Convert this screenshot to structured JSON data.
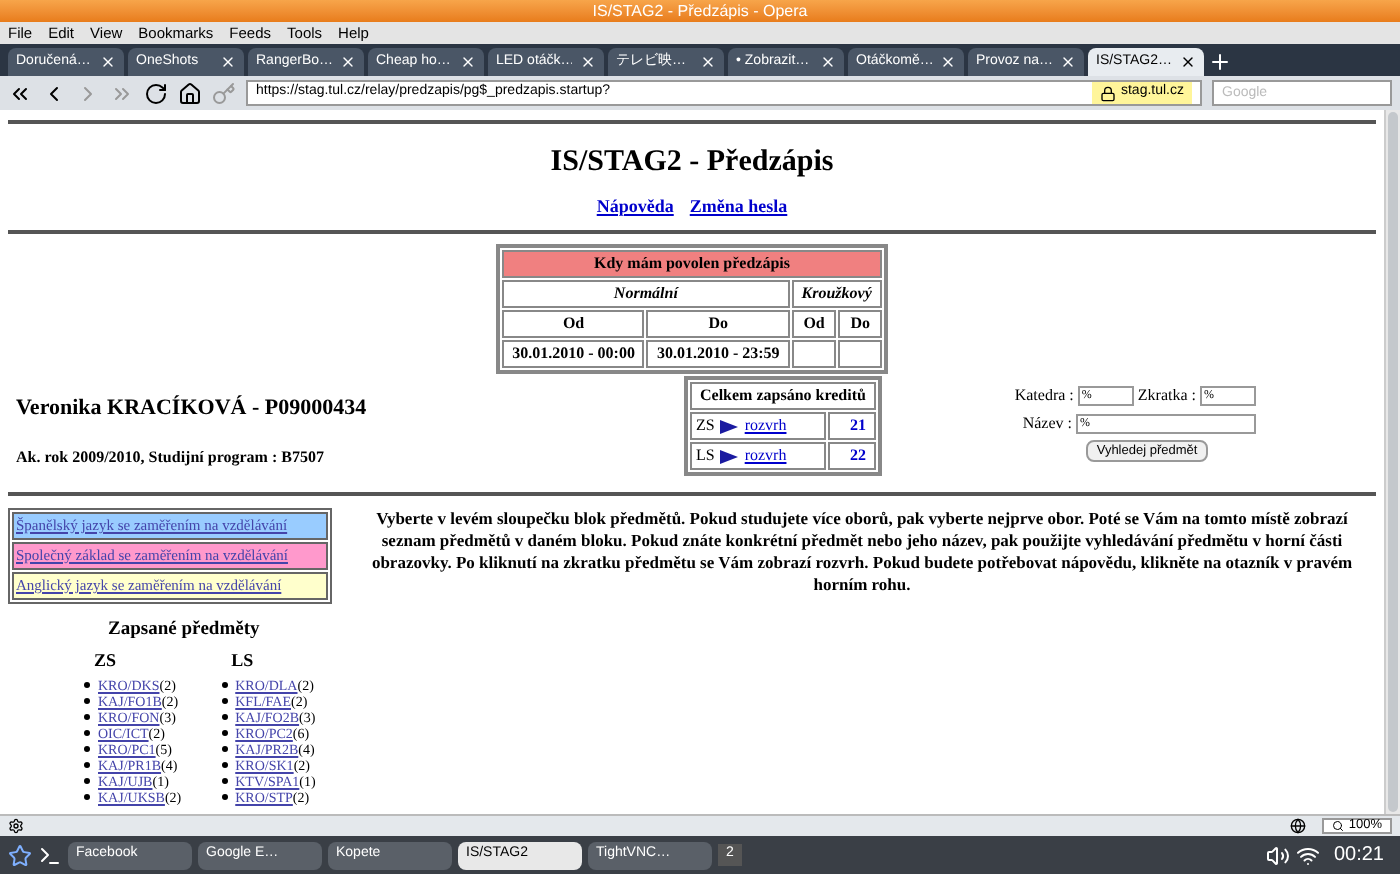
{
  "window": {
    "title": "IS/STAG2 - Předzápis - Opera"
  },
  "menu": [
    "File",
    "Edit",
    "View",
    "Bookmarks",
    "Feeds",
    "Tools",
    "Help"
  ],
  "tabs": [
    {
      "label": "Doručená…",
      "selected": false
    },
    {
      "label": "OneShots",
      "selected": false
    },
    {
      "label": "RangerBo…",
      "selected": false
    },
    {
      "label": "Cheap ho…",
      "selected": false
    },
    {
      "label": "LED otáčk…",
      "selected": false
    },
    {
      "label": "テレビ映…",
      "selected": false
    },
    {
      "label": "• Zobrazit…",
      "selected": false
    },
    {
      "label": "Otáčkomě…",
      "selected": false
    },
    {
      "label": "Provoz na…",
      "selected": false
    },
    {
      "label": "IS/STAG2…",
      "selected": true
    }
  ],
  "address": {
    "url": "https://stag.tul.cz/relay/predzapis/pg$_predzapis.startup?",
    "site": "stag.tul.cz",
    "search_placeholder": "Google"
  },
  "page": {
    "title": "IS/STAG2 - Předzápis",
    "links": [
      "Nápověda",
      "Změna hesla"
    ],
    "schedule": {
      "title": "Kdy mám povolen předzápis",
      "groups": [
        "Normální",
        "Kroužkový"
      ],
      "columns": [
        "Od",
        "Do",
        "Od",
        "Do"
      ],
      "row": [
        "30.01.2010 - 00:00",
        "30.01.2010 - 23:59"
      ]
    },
    "student": {
      "name": "Veronika KRACÍKOVÁ - P09000434",
      "program": "Ak. rok 2009/2010, Studijní program : B7507"
    },
    "credits": {
      "title": "Celkem zapsáno kreditů",
      "rows": [
        {
          "term": "ZS",
          "link": "rozvrh",
          "total": "21"
        },
        {
          "term": "LS",
          "link": "rozvrh",
          "total": "22"
        }
      ]
    },
    "search": {
      "fields": [
        {
          "label": "Katedra :",
          "value": "%"
        },
        {
          "label": "Zkratka :",
          "value": "%"
        },
        {
          "label": "Název :",
          "value": "%"
        }
      ],
      "button": "Vyhledej předmět"
    },
    "blocks": [
      {
        "label": "Španělský jazyk se zaměřením na vzdělávání",
        "color": "#99ccff"
      },
      {
        "label": "Společný základ se zaměřením na vzdělávání",
        "color": "#ff99cc"
      },
      {
        "label": "Anglický jazyk se zaměřením na vzdělávání",
        "color": "#ffffcc"
      }
    ],
    "instructions": "Vyberte v levém sloupečku blok předmětů. Pokud studujete více oborů, pak vyberte nejprve obor. Poté se Vám na tomto místě zobrazí seznam předmětů v daném bloku. Pokud znáte konkrétní předmět nebo jeho název, pak použijte vyhledávání předmětu v horní části obrazovky. Po kliknutí na zkratku předmětu se Vám zobrazí rozvrh. Pokud budete potřebovat nápovědu, klikněte na otazník v pravém horním rohu.",
    "enrolled": {
      "title": "Zapsané předměty",
      "terms": [
        {
          "name": "ZS",
          "courses": [
            {
              "code": "KRO/DKS",
              "count": "(2)"
            },
            {
              "code": "KAJ/FO1B",
              "count": "(2)"
            },
            {
              "code": "KRO/FON",
              "count": "(3)"
            },
            {
              "code": "OIC/ICT",
              "count": "(2)"
            },
            {
              "code": "KRO/PC1",
              "count": "(5)"
            },
            {
              "code": "KAJ/PR1B",
              "count": "(4)"
            },
            {
              "code": "KAJ/UJB",
              "count": "(1)"
            },
            {
              "code": "KAJ/UKSB",
              "count": "(2)"
            }
          ]
        },
        {
          "name": "LS",
          "courses": [
            {
              "code": "KRO/DLA",
              "count": "(2)"
            },
            {
              "code": "KFL/FAE",
              "count": "(2)"
            },
            {
              "code": "KAJ/FO2B",
              "count": "(3)"
            },
            {
              "code": "KRO/PC2",
              "count": "(6)"
            },
            {
              "code": "KAJ/PR2B",
              "count": "(4)"
            },
            {
              "code": "KRO/SK1",
              "count": "(2)"
            },
            {
              "code": "KTV/SPA1",
              "count": "(1)"
            },
            {
              "code": "KRO/STP",
              "count": "(2)"
            }
          ]
        }
      ]
    }
  },
  "status_bar": {
    "zoom": "100%"
  },
  "taskbar": {
    "tasks": [
      {
        "label": "Facebook",
        "selected": false
      },
      {
        "label": "Google E…",
        "selected": false
      },
      {
        "label": "Kopete",
        "selected": false
      },
      {
        "label": "IS/STAG2",
        "selected": true
      },
      {
        "label": "TightVNC…",
        "selected": false
      }
    ],
    "pager": "2",
    "clock": "00:21"
  }
}
